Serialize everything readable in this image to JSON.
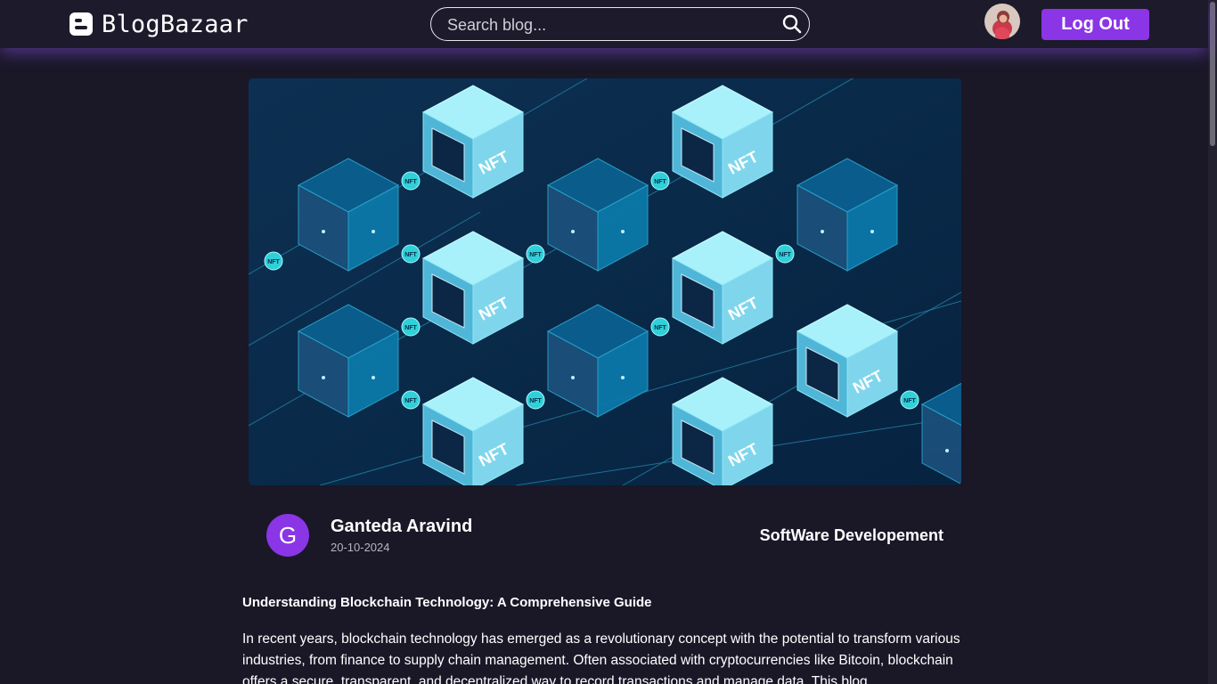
{
  "navbar": {
    "brand": "BlogBazaar",
    "brand_icon": "blogger-icon",
    "search": {
      "placeholder": "Search blog...",
      "value": "",
      "icon": "search-icon"
    },
    "avatar_icon": "user-avatar",
    "logout_label": "Log Out"
  },
  "post": {
    "hero_image": "nft-blockchain-illustration",
    "hero_image_text": "NFT",
    "author": {
      "initial": "G",
      "name": "Ganteda Aravind"
    },
    "date": "20-10-2024",
    "category": "SoftWare Developement",
    "title": "Understanding Blockchain Technology: A Comprehensive Guide",
    "body": "In recent years, blockchain technology has emerged as a revolutionary concept with the potential to transform various industries, from finance to supply chain management. Often associated with cryptocurrencies like Bitcoin, blockchain offers a secure, transparent, and decentralized way to record transactions and manage data. This blog"
  },
  "colors": {
    "background": "#1a1727",
    "navbar": "#1d1a2b",
    "accent": "#8a35e6",
    "hero_background": "#0b2a48",
    "cube_light": "#9feefc",
    "cube_dark": "#0a5f8f"
  }
}
